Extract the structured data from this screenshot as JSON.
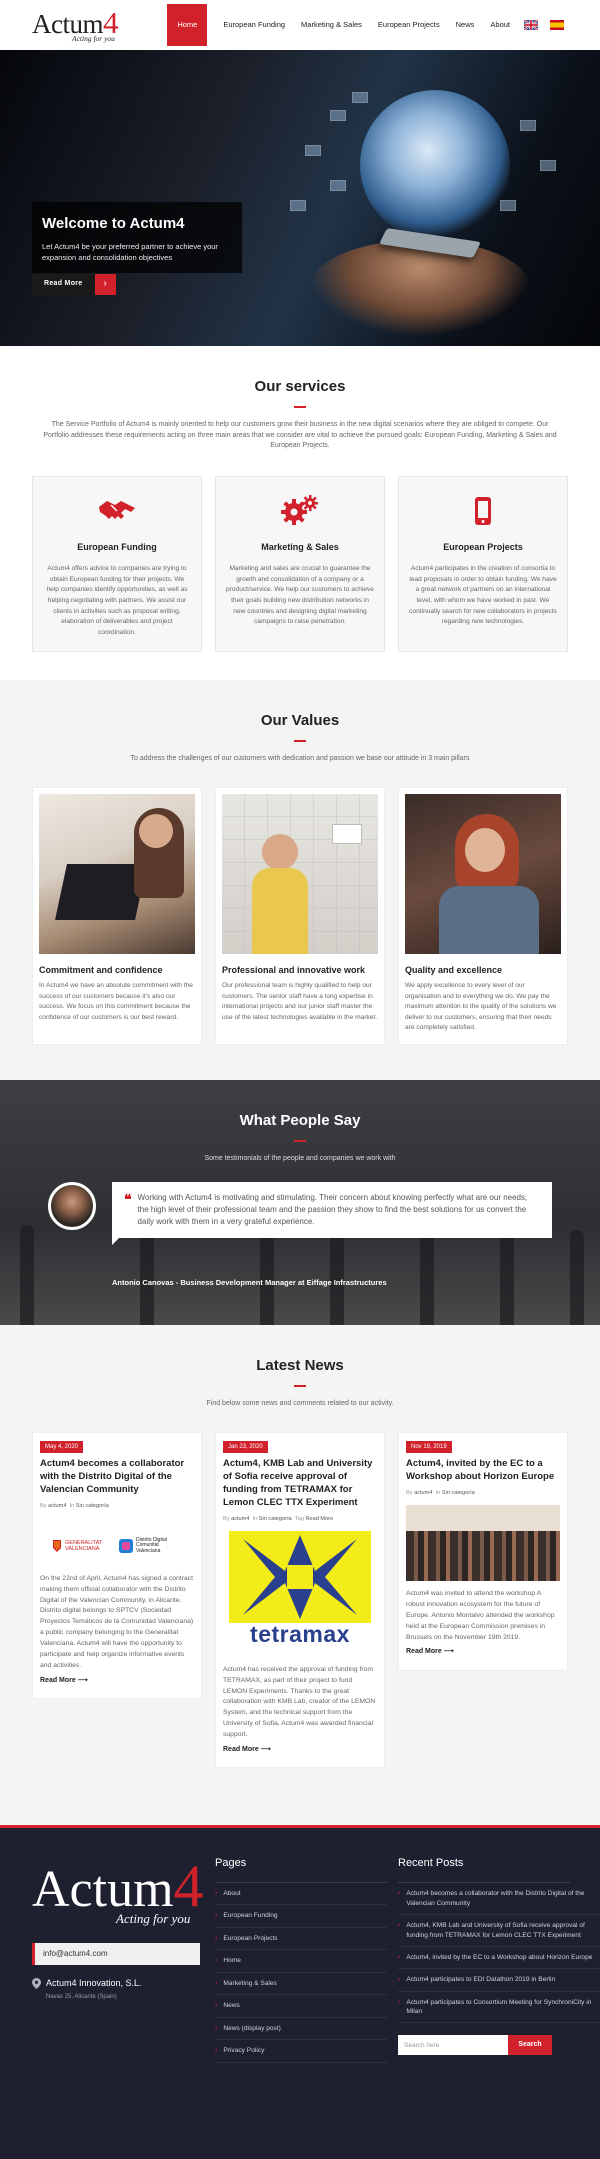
{
  "brand": {
    "logo_text": "Actum",
    "logo_digit": "4",
    "tagline": "Acting for you"
  },
  "nav": {
    "items": [
      "Home",
      "European Funding",
      "Marketing & Sales",
      "European Projects",
      "News",
      "About"
    ],
    "active": "Home",
    "flags": [
      "english-flag-icon",
      "spanish-flag-icon"
    ]
  },
  "hero": {
    "title": "Welcome to Actum4",
    "text": "Let Actum4 be your preferred partner to achieve your expansion and consolidation objectives",
    "button": "Read More"
  },
  "services": {
    "title": "Our services",
    "intro": "The Service Portfolio of Actum4 is mainly oriented to help our customers grow their business in the new digital scenarios where they are obliged to compete. Our Portfolio addresses these requirements acting on three main areas that we consider are vital to achieve the pursued goals: European Funding, Marketing & Sales and European Projects.",
    "items": [
      {
        "title": "European Funding",
        "icon": "handshake-icon",
        "text": "Actum4 offers advice to companies are trying to obtain European funding for their projects. We help companies identify opportunities, as well as helping negotiating with partners. We assist our clients in activities such as proposal writing, elaboration of deliverables and project coordination."
      },
      {
        "title": "Marketing & Sales",
        "icon": "gears-icon",
        "text": "Marketing and sales are crucial to guarantee the growth and consolidation of a company or a product/service. We help our customers to achieve their goals building new distribution networks in new countries and designing digital marketing campaigns to raise penetration."
      },
      {
        "title": "European Projects",
        "icon": "mobile-phone-icon",
        "text": "Actum4 participates in the creation of consortia to lead proposals in order to obtain funding. We have a great network of partners on an international level, with whom we have worked in past. We continually search for new collaborators in projects regarding new technologies."
      }
    ]
  },
  "values": {
    "title": "Our Values",
    "intro": "To address the challenges of our customers with dedication and passion we base our attitude in 3 main pillars",
    "items": [
      {
        "title": "Commitment and confidence",
        "text": "In Actum4 we have an absolute commitment with the success of our customers because it's also our success. We focus on this commitment because the confidence of our customers is our best reward."
      },
      {
        "title": "Professional and innovative work",
        "text": "Our professional team is highly qualified to help our customers. The senior staff have a long expertise in international projects and our junior staff master the use of the latest technologies available in the market."
      },
      {
        "title": "Quality and excellence",
        "text": "We apply excellence to every level of our organisation and to everything we do. We pay the maximum attention to the quality of the solutions we deliver to our customers, ensuring that their needs are completely satisfied."
      }
    ]
  },
  "testimonials": {
    "title": "What People Say",
    "intro": "Some testimonials of the people and companies we work with",
    "quote": "Working with Actum4 is motivating and stimulating. Their concern about knowing perfectly what are our needs, the high level of their professional team and the passion they show to find the best solutions for us convert the daily work with them in a very grateful experience.",
    "author": "Antonio Canovas - Business Development Manager at Eiffage Infrastructures"
  },
  "news": {
    "title": "Latest News",
    "intro": "Find below some news and comments related to our activity.",
    "by_label": "By",
    "in_label": "In",
    "tag_label": "Tag",
    "read_more": "Read More",
    "posts": [
      {
        "date": "May 4, 2020",
        "title": "Actum4 becomes a collaborator with the Distrito Digital of the Valencian Community",
        "author": "actum4",
        "category": "Sin categoría",
        "logo_a": "GENERALITAT VALENCIANA",
        "logo_b": "Distrito Digital Comunitat Valenciana",
        "text": "On the 22nd of April, Actum4 has signed a contract making them official collaborator with the Distrito Digital of the Valencian Community, in Alicante. Distrito digital belongs to SPTCV (Sociedad Proyectos Temáticos de la Comunidad Valenciana) a public company belonging to the Generalitat Valenciana. Actum4 will have the opportunity to participate and help organize informative events and activities."
      },
      {
        "date": "Jan 23, 2020",
        "title": "Actum4, KMB Lab and University of Sofia receive approval of funding from TETRAMAX for Lemon CLEC TTX Experiment",
        "author": "actum4",
        "category": "Sin categoría",
        "tag": "Read More",
        "logo_text": "tetramax",
        "text": "Actum4 has received the approval of funding from TETRAMAX, as part of their project to fund LEMON Experiments. Thanks to the great collaboration with KMB Lab, creator of the LEMON System, and the technical support from the University of Sofia, Actum4 was awarded financial support."
      },
      {
        "date": "Nov 19, 2019",
        "title": "Actum4, invited by the EC to a Workshop about Horizon Europe",
        "author": "actum4",
        "category": "Sin categoría",
        "text": "Actum4 was invited to attend the workshop A robust innovation ecosystem for the future of Europe. Antonio Montalvo attended the workshop held at the European Commission premises in Brussels on the November 19th 2019."
      }
    ]
  },
  "footer": {
    "email": "info@actum4.com",
    "company": "Actum4 Innovation, S.L.",
    "address": "Navas 25, Alicante (Spain)",
    "pages_title": "Pages",
    "pages": [
      "About",
      "European Funding",
      "European Projects",
      "Home",
      "Marketing & Sales",
      "News",
      "News (display post)",
      "Privacy Policy"
    ],
    "recent_title": "Recent Posts",
    "recent": [
      "Actum4 becomes a collaborator with the Distrito Digital of the Valencian Community",
      "Actum4, KMB Lab and University of Sofia receive approval of funding from TETRAMAX for Lemon CLEC TTX Experiment",
      "Actum4, invited by the EC to a Workshop about Horizon Europe",
      "Actum4 participates to EDI Datathon 2019 in Berlin",
      "Actum4 participates to Consortium Meeting for SynchroniCity in Milan"
    ],
    "search_placeholder": "Search here",
    "search_button": "Search"
  },
  "colors": {
    "accent": "#d1222b",
    "footer_bg": "#1e2030",
    "section_bg": "#f4f4f4"
  }
}
